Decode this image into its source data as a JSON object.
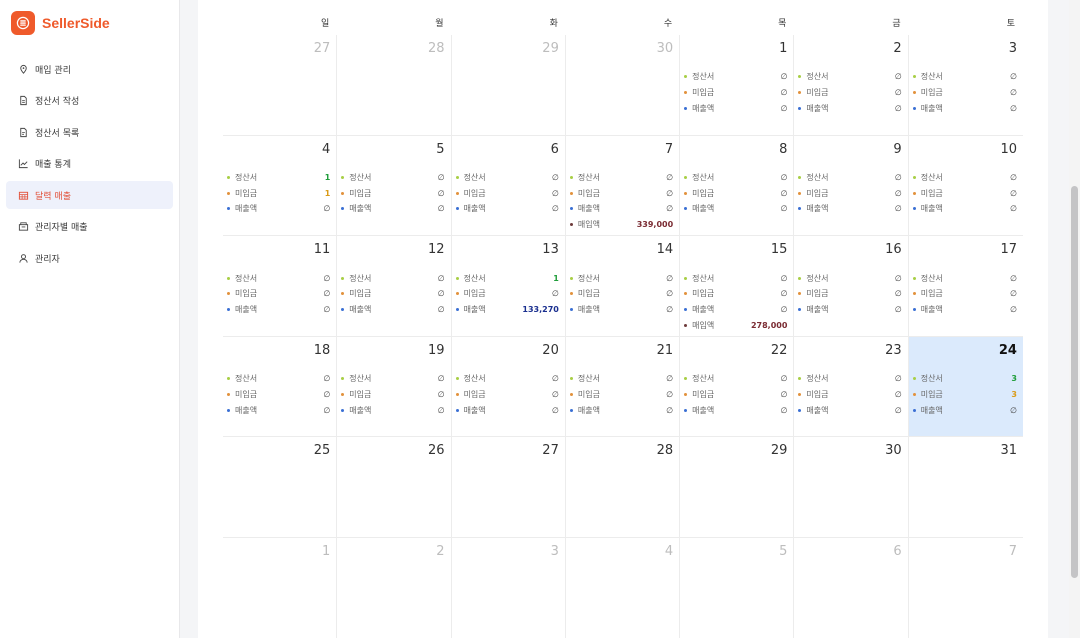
{
  "brand": {
    "name": "SellerSide"
  },
  "nav": [
    {
      "label": "매입 관리",
      "icon": "tag-icon",
      "active": false
    },
    {
      "label": "정산서 작성",
      "icon": "document-icon",
      "active": false
    },
    {
      "label": "정산서 목록",
      "icon": "document-list-icon",
      "active": false
    },
    {
      "label": "매출 통계",
      "icon": "line-chart-icon",
      "active": false
    },
    {
      "label": "달력 매출",
      "icon": "calendar-icon",
      "active": true
    },
    {
      "label": "관리자별 매출",
      "icon": "store-icon",
      "active": false
    },
    {
      "label": "관리자",
      "icon": "user-icon",
      "active": false
    }
  ],
  "weekdays": [
    "일",
    "월",
    "화",
    "수",
    "목",
    "금",
    "토"
  ],
  "colors": {
    "accent": "#ef5a2b",
    "dot_statement": "#a8cf45",
    "dot_unpaid": "#e2913c",
    "dot_sales": "#3a6fd4",
    "dot_purchase": "#6e3b3b",
    "val_green": "#1f9d3a",
    "val_orange": "#d99a17",
    "val_blue": "#1a2f8f",
    "val_maroon": "#7a2b32"
  },
  "weeks": [
    [
      {
        "num": "27",
        "muted": true,
        "entries": []
      },
      {
        "num": "28",
        "muted": true,
        "entries": []
      },
      {
        "num": "29",
        "muted": true,
        "entries": []
      },
      {
        "num": "30",
        "muted": true,
        "entries": []
      },
      {
        "num": "1",
        "entries": [
          {
            "label": "정산서",
            "value": "∅",
            "kind": "statement"
          },
          {
            "label": "미입금",
            "value": "∅",
            "kind": "unpaid"
          },
          {
            "label": "매출액",
            "value": "∅",
            "kind": "sales"
          }
        ]
      },
      {
        "num": "2",
        "entries": [
          {
            "label": "정산서",
            "value": "∅",
            "kind": "statement"
          },
          {
            "label": "미입금",
            "value": "∅",
            "kind": "unpaid"
          },
          {
            "label": "매출액",
            "value": "∅",
            "kind": "sales"
          }
        ]
      },
      {
        "num": "3",
        "entries": [
          {
            "label": "정산서",
            "value": "∅",
            "kind": "statement"
          },
          {
            "label": "미입금",
            "value": "∅",
            "kind": "unpaid"
          },
          {
            "label": "매출액",
            "value": "∅",
            "kind": "sales"
          }
        ]
      }
    ],
    [
      {
        "num": "4",
        "entries": [
          {
            "label": "정산서",
            "value": "1",
            "kind": "statement",
            "valueColor": "green"
          },
          {
            "label": "미입금",
            "value": "1",
            "kind": "unpaid",
            "valueColor": "orange"
          },
          {
            "label": "매출액",
            "value": "∅",
            "kind": "sales"
          }
        ]
      },
      {
        "num": "5",
        "entries": [
          {
            "label": "정산서",
            "value": "∅",
            "kind": "statement"
          },
          {
            "label": "미입금",
            "value": "∅",
            "kind": "unpaid"
          },
          {
            "label": "매출액",
            "value": "∅",
            "kind": "sales"
          }
        ]
      },
      {
        "num": "6",
        "entries": [
          {
            "label": "정산서",
            "value": "∅",
            "kind": "statement"
          },
          {
            "label": "미입금",
            "value": "∅",
            "kind": "unpaid"
          },
          {
            "label": "매출액",
            "value": "∅",
            "kind": "sales"
          }
        ]
      },
      {
        "num": "7",
        "entries": [
          {
            "label": "정산서",
            "value": "∅",
            "kind": "statement"
          },
          {
            "label": "미입금",
            "value": "∅",
            "kind": "unpaid"
          },
          {
            "label": "매출액",
            "value": "∅",
            "kind": "sales"
          },
          {
            "label": "매입액",
            "value": "339,000",
            "kind": "purchase",
            "valueColor": "maroon"
          }
        ]
      },
      {
        "num": "8",
        "entries": [
          {
            "label": "정산서",
            "value": "∅",
            "kind": "statement"
          },
          {
            "label": "미입금",
            "value": "∅",
            "kind": "unpaid"
          },
          {
            "label": "매출액",
            "value": "∅",
            "kind": "sales"
          }
        ]
      },
      {
        "num": "9",
        "entries": [
          {
            "label": "정산서",
            "value": "∅",
            "kind": "statement"
          },
          {
            "label": "미입금",
            "value": "∅",
            "kind": "unpaid"
          },
          {
            "label": "매출액",
            "value": "∅",
            "kind": "sales"
          }
        ]
      },
      {
        "num": "10",
        "entries": [
          {
            "label": "정산서",
            "value": "∅",
            "kind": "statement"
          },
          {
            "label": "미입금",
            "value": "∅",
            "kind": "unpaid"
          },
          {
            "label": "매출액",
            "value": "∅",
            "kind": "sales"
          }
        ]
      }
    ],
    [
      {
        "num": "11",
        "entries": [
          {
            "label": "정산서",
            "value": "∅",
            "kind": "statement"
          },
          {
            "label": "미입금",
            "value": "∅",
            "kind": "unpaid"
          },
          {
            "label": "매출액",
            "value": "∅",
            "kind": "sales"
          }
        ]
      },
      {
        "num": "12",
        "entries": [
          {
            "label": "정산서",
            "value": "∅",
            "kind": "statement"
          },
          {
            "label": "미입금",
            "value": "∅",
            "kind": "unpaid"
          },
          {
            "label": "매출액",
            "value": "∅",
            "kind": "sales"
          }
        ]
      },
      {
        "num": "13",
        "entries": [
          {
            "label": "정산서",
            "value": "1",
            "kind": "statement",
            "valueColor": "green"
          },
          {
            "label": "미입금",
            "value": "∅",
            "kind": "unpaid"
          },
          {
            "label": "매출액",
            "value": "133,270",
            "kind": "sales",
            "valueColor": "blue"
          }
        ]
      },
      {
        "num": "14",
        "entries": [
          {
            "label": "정산서",
            "value": "∅",
            "kind": "statement"
          },
          {
            "label": "미입금",
            "value": "∅",
            "kind": "unpaid"
          },
          {
            "label": "매출액",
            "value": "∅",
            "kind": "sales"
          }
        ]
      },
      {
        "num": "15",
        "entries": [
          {
            "label": "정산서",
            "value": "∅",
            "kind": "statement"
          },
          {
            "label": "미입금",
            "value": "∅",
            "kind": "unpaid"
          },
          {
            "label": "매출액",
            "value": "∅",
            "kind": "sales"
          },
          {
            "label": "매입액",
            "value": "278,000",
            "kind": "purchase",
            "valueColor": "maroon"
          }
        ]
      },
      {
        "num": "16",
        "entries": [
          {
            "label": "정산서",
            "value": "∅",
            "kind": "statement"
          },
          {
            "label": "미입금",
            "value": "∅",
            "kind": "unpaid"
          },
          {
            "label": "매출액",
            "value": "∅",
            "kind": "sales"
          }
        ]
      },
      {
        "num": "17",
        "entries": [
          {
            "label": "정산서",
            "value": "∅",
            "kind": "statement"
          },
          {
            "label": "미입금",
            "value": "∅",
            "kind": "unpaid"
          },
          {
            "label": "매출액",
            "value": "∅",
            "kind": "sales"
          }
        ]
      }
    ],
    [
      {
        "num": "18",
        "entries": [
          {
            "label": "정산서",
            "value": "∅",
            "kind": "statement"
          },
          {
            "label": "미입금",
            "value": "∅",
            "kind": "unpaid"
          },
          {
            "label": "매출액",
            "value": "∅",
            "kind": "sales"
          }
        ]
      },
      {
        "num": "19",
        "entries": [
          {
            "label": "정산서",
            "value": "∅",
            "kind": "statement"
          },
          {
            "label": "미입금",
            "value": "∅",
            "kind": "unpaid"
          },
          {
            "label": "매출액",
            "value": "∅",
            "kind": "sales"
          }
        ]
      },
      {
        "num": "20",
        "entries": [
          {
            "label": "정산서",
            "value": "∅",
            "kind": "statement"
          },
          {
            "label": "미입금",
            "value": "∅",
            "kind": "unpaid"
          },
          {
            "label": "매출액",
            "value": "∅",
            "kind": "sales"
          }
        ]
      },
      {
        "num": "21",
        "entries": [
          {
            "label": "정산서",
            "value": "∅",
            "kind": "statement"
          },
          {
            "label": "미입금",
            "value": "∅",
            "kind": "unpaid"
          },
          {
            "label": "매출액",
            "value": "∅",
            "kind": "sales"
          }
        ]
      },
      {
        "num": "22",
        "entries": [
          {
            "label": "정산서",
            "value": "∅",
            "kind": "statement"
          },
          {
            "label": "미입금",
            "value": "∅",
            "kind": "unpaid"
          },
          {
            "label": "매출액",
            "value": "∅",
            "kind": "sales"
          }
        ]
      },
      {
        "num": "23",
        "entries": [
          {
            "label": "정산서",
            "value": "∅",
            "kind": "statement"
          },
          {
            "label": "미입금",
            "value": "∅",
            "kind": "unpaid"
          },
          {
            "label": "매출액",
            "value": "∅",
            "kind": "sales"
          }
        ]
      },
      {
        "num": "24",
        "today": true,
        "entries": [
          {
            "label": "정산서",
            "value": "3",
            "kind": "statement",
            "valueColor": "green"
          },
          {
            "label": "미입금",
            "value": "3",
            "kind": "unpaid",
            "valueColor": "orange"
          },
          {
            "label": "매출액",
            "value": "∅",
            "kind": "sales"
          }
        ]
      }
    ],
    [
      {
        "num": "25",
        "entries": []
      },
      {
        "num": "26",
        "entries": []
      },
      {
        "num": "27",
        "entries": []
      },
      {
        "num": "28",
        "entries": []
      },
      {
        "num": "29",
        "entries": []
      },
      {
        "num": "30",
        "entries": []
      },
      {
        "num": "31",
        "entries": []
      }
    ],
    [
      {
        "num": "1",
        "muted": true,
        "entries": []
      },
      {
        "num": "2",
        "muted": true,
        "entries": []
      },
      {
        "num": "3",
        "muted": true,
        "entries": []
      },
      {
        "num": "4",
        "muted": true,
        "entries": []
      },
      {
        "num": "5",
        "muted": true,
        "entries": []
      },
      {
        "num": "6",
        "muted": true,
        "entries": []
      },
      {
        "num": "7",
        "muted": true,
        "entries": []
      }
    ]
  ]
}
